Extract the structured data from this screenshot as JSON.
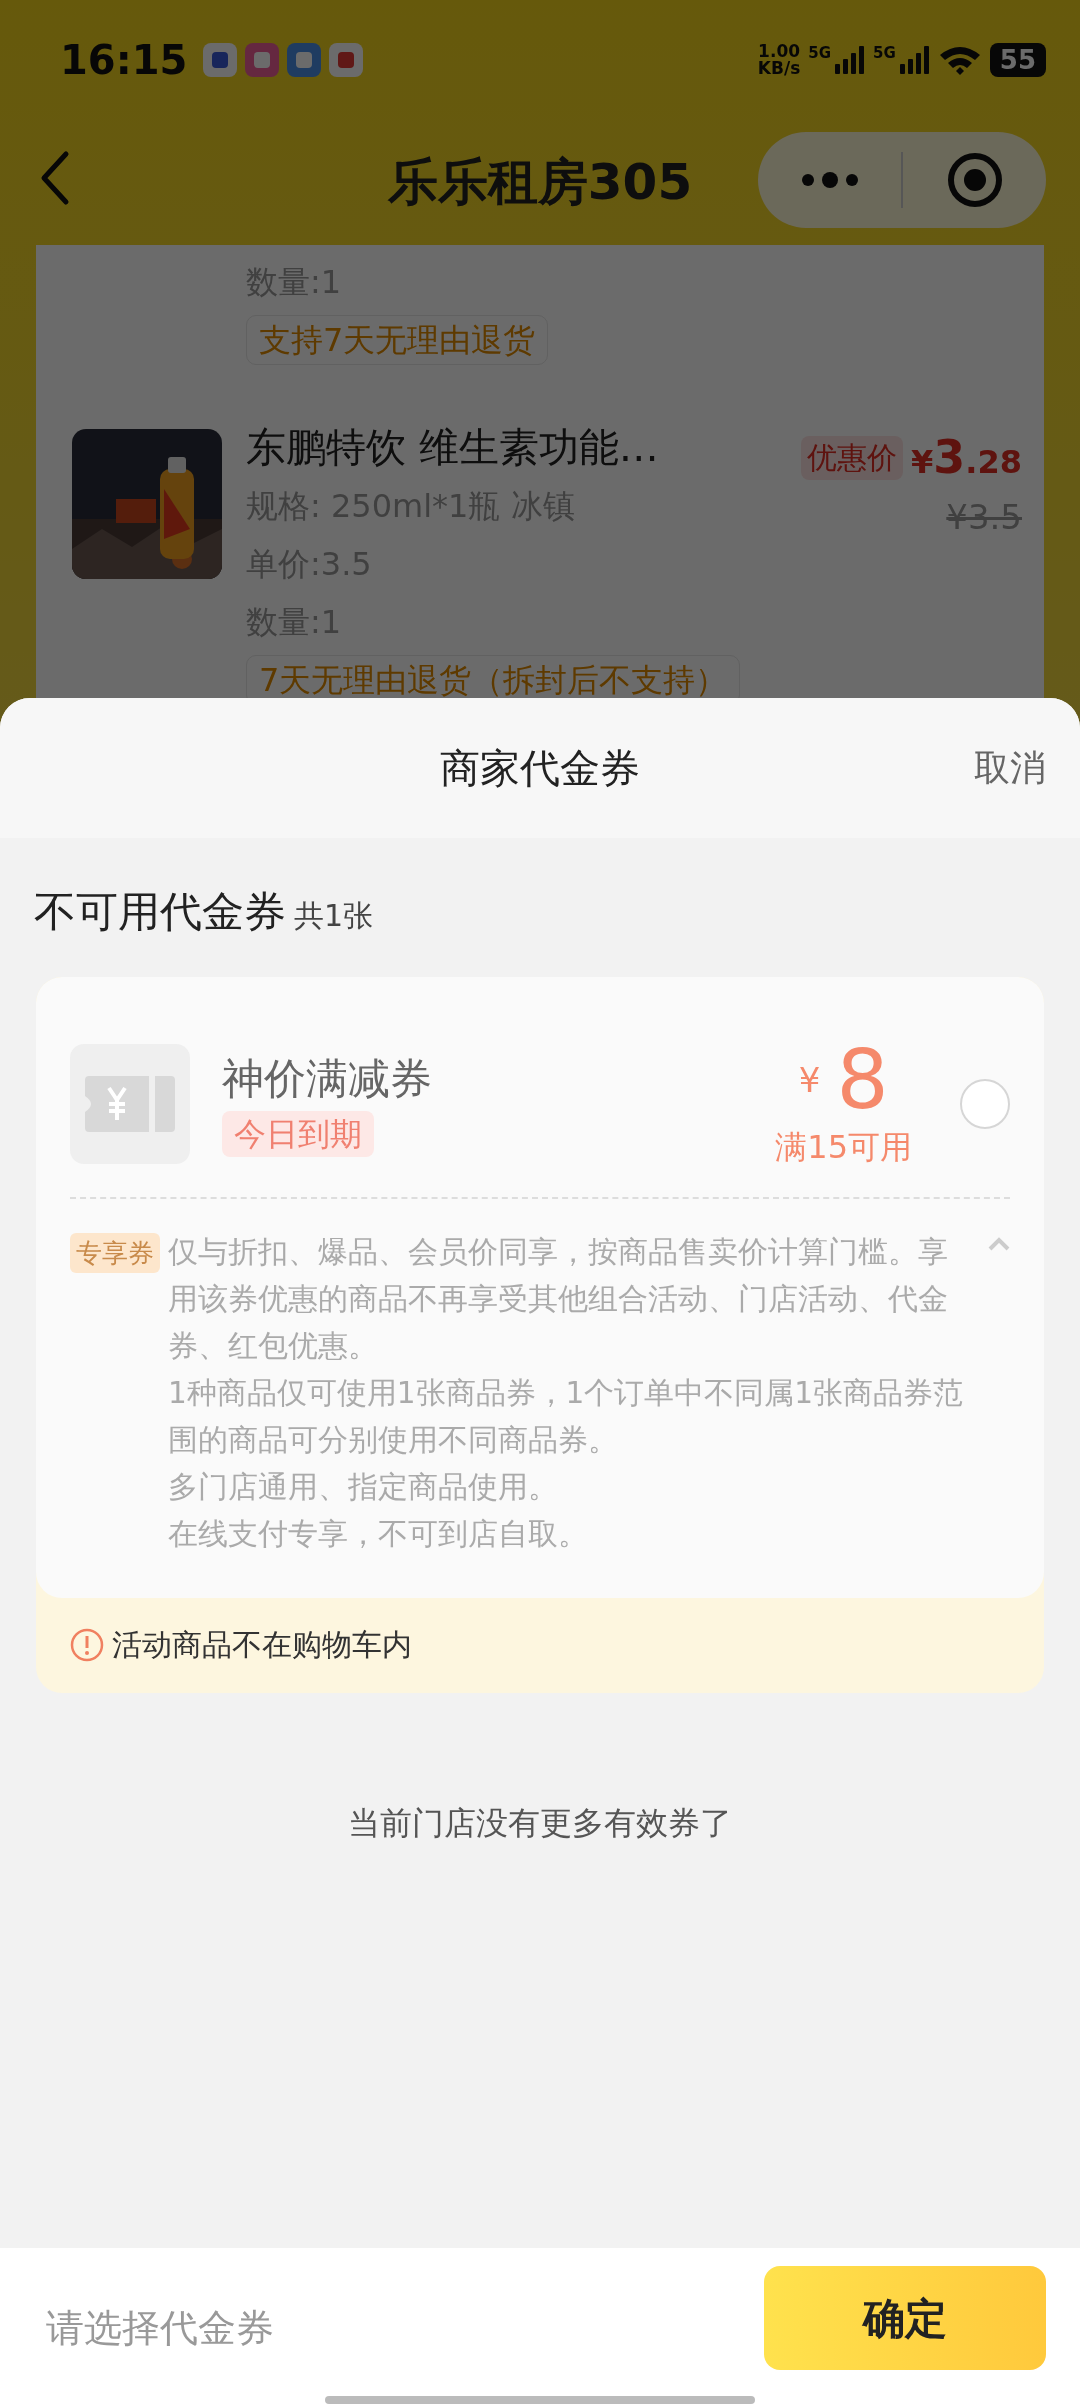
{
  "status_bar": {
    "time": "16:15",
    "net_speed": [
      "1.00",
      "KB/s"
    ],
    "sims": [
      "5G",
      "5G"
    ],
    "battery": "55"
  },
  "header": {
    "title": "乐乐租房305"
  },
  "order_items": [
    {
      "quantity": "数量:1",
      "tag": "支持7天无理由退货"
    },
    {
      "name": "东鹏特饮 维生素功能…",
      "spec": "规格: 250ml*1瓶 冰镇",
      "unit_price": "单价:3.5",
      "quantity": "数量:1",
      "tag": "7天无理由退货（拆封后不支持）",
      "price_label": "优惠价",
      "price": {
        "symbol": "¥",
        "integer": "3",
        "decimal": ".28"
      },
      "original_price": "¥3.5"
    }
  ],
  "sheet": {
    "title": "商家代金券",
    "cancel": "取消",
    "section_title": "不可用代金券",
    "section_count": "共1张",
    "coupons": [
      {
        "name": "神价满减券",
        "expiry_tag": "今日到期",
        "currency": "¥",
        "amount": "8",
        "condition": "满15可用",
        "selected": false,
        "type_tag": "专享券",
        "expanded": true,
        "rules": [
          "仅与折扣、爆品、会员价同享，按商品售卖价计算门槛。享用该券优惠的商品不再享受其他组合活动、门店活动、代金券、红包优惠。",
          "1种商品仅可使用1张商品券，1个订单中不同属1张商品券范围的商品可分别使用不同商品券。",
          "多门店通用、指定商品使用。",
          "在线支付专享，不可到店自取。"
        ],
        "notice": "活动商品不在购物车内"
      }
    ],
    "footer_note": "当前门店没有更多有效券了"
  },
  "bottom_bar": {
    "hint": "请选择代金券",
    "confirm": "确定"
  }
}
